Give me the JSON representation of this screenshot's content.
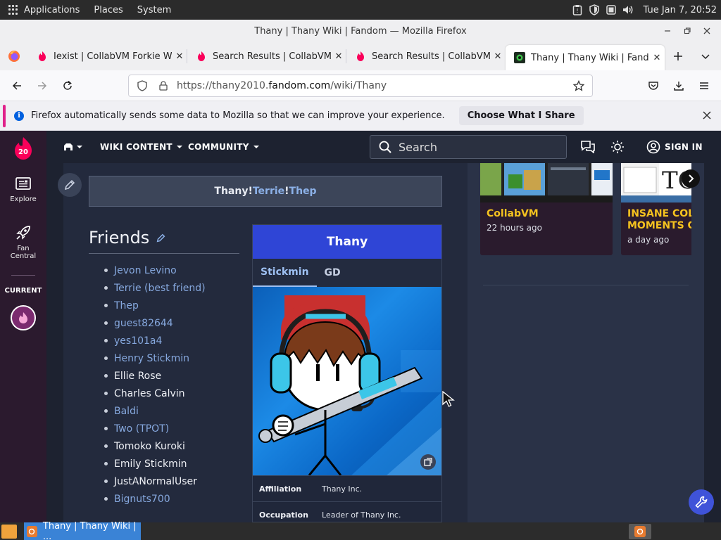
{
  "gnome": {
    "menus": [
      "Applications",
      "Places",
      "System"
    ],
    "clock": "Tue Jan  7, 20:52"
  },
  "window": {
    "title": "Thany | Thany Wiki | Fandom — Mozilla Firefox"
  },
  "tabs": [
    {
      "title": "Iexist | CollabVM Forkie Wiki",
      "active": false
    },
    {
      "title": "Search Results | CollabVM Fo",
      "active": false
    },
    {
      "title": "Search Results | CollabVM Fo",
      "active": false
    },
    {
      "title": "Thany | Thany Wiki | Fandom",
      "active": true
    }
  ],
  "urlbar": {
    "prefix": "https://thany2010.",
    "domain": "fandom.com",
    "path": "/wiki/Thany"
  },
  "notification": {
    "message": "Firefox automatically sends some data to Mozilla so that we can improve your experience.",
    "button": "Choose What I Share"
  },
  "fandom_rail": {
    "badge": "20",
    "explore": "Explore",
    "fan_central_1": "Fan",
    "fan_central_2": "Central",
    "current": "CURRENT"
  },
  "wiki_nav": {
    "wiki_content": "WIKI CONTENT",
    "community": "COMMUNITY",
    "search_placeholder": "Search",
    "sign_in": "SIGN IN"
  },
  "navbox": {
    "part1": "Thany!",
    "part2": "Terrie",
    "part3": "!",
    "part4": "Thep"
  },
  "friends": {
    "heading": "Friends",
    "items": [
      {
        "name": "Jevon Levino",
        "link": true
      },
      {
        "name": "Terrie (best friend)",
        "link": true
      },
      {
        "name": "Thep",
        "link": true
      },
      {
        "name": "guest82644",
        "link": true
      },
      {
        "name": "yes101a4",
        "link": true
      },
      {
        "name": "Henry Stickmin",
        "link": true
      },
      {
        "name": "Ellie Rose",
        "link": false
      },
      {
        "name": "Charles Calvin",
        "link": false
      },
      {
        "name": "Baldi",
        "link": true
      },
      {
        "name": "Two (TPOT)",
        "link": true
      },
      {
        "name": "Tomoko Kuroki",
        "link": false
      },
      {
        "name": "Emily Stickmin",
        "link": false
      },
      {
        "name": "JustANormalUser",
        "link": false
      },
      {
        "name": "Bignuts700",
        "link": true
      }
    ]
  },
  "infobox": {
    "title": "Thany",
    "tabs": [
      "Stickmin",
      "GD"
    ],
    "rows": [
      {
        "label": "Affiliation",
        "value": "Thany Inc."
      },
      {
        "label": "Occupation",
        "value": "Leader of Thany Inc."
      }
    ]
  },
  "cards": [
    {
      "title": "CollabVM",
      "date": "22 hours ago"
    },
    {
      "title_1": "INSANE COLL",
      "title_2": "MOMENTS CA",
      "date": "a day ago"
    }
  ],
  "taskbar": {
    "window_label": "Thany | Thany Wiki | ..."
  },
  "colors": {
    "fandom_rail": "#2b1a2e",
    "infobox_header": "#2f45d6",
    "link": "#86a8de",
    "card_title": "#f4c21f"
  }
}
